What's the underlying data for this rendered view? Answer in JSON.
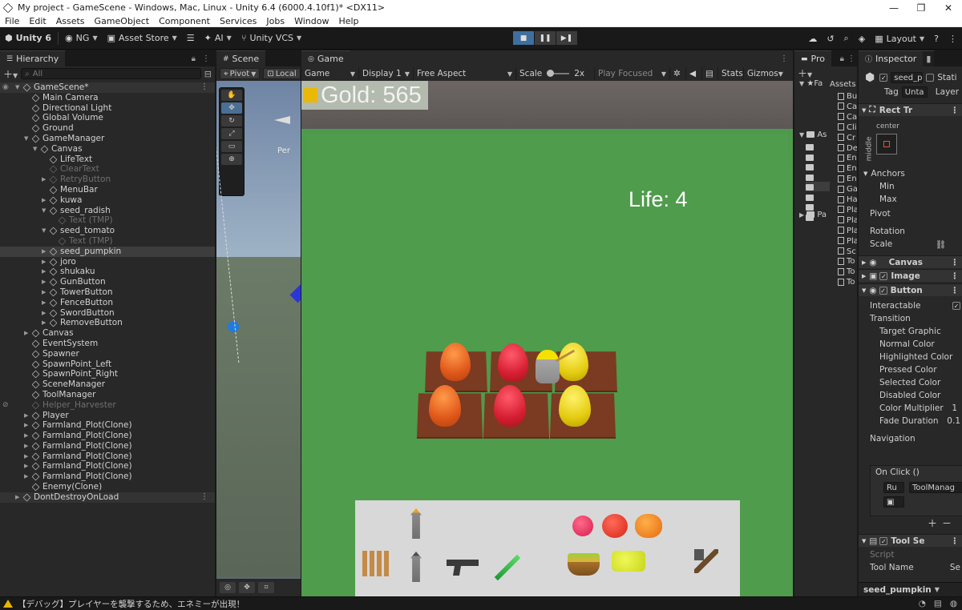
{
  "window": {
    "title": "My project - GameScene - Windows, Mac, Linux - Unity 6.4 (6000.4.10f1)* <DX11>",
    "minimize": "—",
    "maximize": "❐",
    "close": "✕"
  },
  "menu": [
    "File",
    "Edit",
    "Assets",
    "GameObject",
    "Component",
    "Services",
    "Jobs",
    "Window",
    "Help"
  ],
  "toolbar": {
    "unity_label": "Unity 6",
    "account": "NG",
    "asset_store": "Asset Store",
    "ai": "AI",
    "vcs": "Unity VCS",
    "layout": "Layout"
  },
  "hierarchy": {
    "tab": "Hierarchy",
    "search_placeholder": "All",
    "rows": [
      {
        "label": "GameScene*",
        "indent": 0,
        "arrow": "down",
        "scene": true
      },
      {
        "label": "Main Camera",
        "indent": 1
      },
      {
        "label": "Directional Light",
        "indent": 1
      },
      {
        "label": "Global Volume",
        "indent": 1
      },
      {
        "label": "Ground",
        "indent": 1
      },
      {
        "label": "GameManager",
        "indent": 1,
        "arrow": "down"
      },
      {
        "label": "Canvas",
        "indent": 2,
        "arrow": "down"
      },
      {
        "label": "LifeText",
        "indent": 3
      },
      {
        "label": "ClearText",
        "indent": 3,
        "dim": true
      },
      {
        "label": "RetryButton",
        "indent": 3,
        "arrow": "right",
        "dim": true
      },
      {
        "label": "MenuBar",
        "indent": 3
      },
      {
        "label": "kuwa",
        "indent": 3,
        "arrow": "right"
      },
      {
        "label": "seed_radish",
        "indent": 3,
        "arrow": "down"
      },
      {
        "label": "Text (TMP)",
        "indent": 4,
        "dim": true
      },
      {
        "label": "seed_tomato",
        "indent": 3,
        "arrow": "down"
      },
      {
        "label": "Text (TMP)",
        "indent": 4,
        "dim": true
      },
      {
        "label": "seed_pumpkin",
        "indent": 3,
        "arrow": "right",
        "selected": true
      },
      {
        "label": "joro",
        "indent": 3,
        "arrow": "right"
      },
      {
        "label": "shukaku",
        "indent": 3,
        "arrow": "right"
      },
      {
        "label": "GunButton",
        "indent": 3,
        "arrow": "right"
      },
      {
        "label": "TowerButton",
        "indent": 3,
        "arrow": "right"
      },
      {
        "label": "FenceButton",
        "indent": 3,
        "arrow": "right"
      },
      {
        "label": "SwordButton",
        "indent": 3,
        "arrow": "right"
      },
      {
        "label": "RemoveButton",
        "indent": 3,
        "arrow": "right"
      },
      {
        "label": "Canvas",
        "indent": 1,
        "arrow": "right"
      },
      {
        "label": "EventSystem",
        "indent": 1
      },
      {
        "label": "Spawner",
        "indent": 1
      },
      {
        "label": "SpawnPoint_Left",
        "indent": 1
      },
      {
        "label": "SpawnPoint_Right",
        "indent": 1
      },
      {
        "label": "SceneManager",
        "indent": 1
      },
      {
        "label": "ToolManager",
        "indent": 1
      },
      {
        "label": "Helper_Harvester",
        "indent": 1,
        "dim": true
      },
      {
        "label": "Player",
        "indent": 1,
        "arrow": "right"
      },
      {
        "label": "Farmland_Plot(Clone)",
        "indent": 1,
        "arrow": "right"
      },
      {
        "label": "Farmland_Plot(Clone)",
        "indent": 1,
        "arrow": "right"
      },
      {
        "label": "Farmland_Plot(Clone)",
        "indent": 1,
        "arrow": "right"
      },
      {
        "label": "Farmland_Plot(Clone)",
        "indent": 1,
        "arrow": "right"
      },
      {
        "label": "Farmland_Plot(Clone)",
        "indent": 1,
        "arrow": "right"
      },
      {
        "label": "Farmland_Plot(Clone)",
        "indent": 1,
        "arrow": "right"
      },
      {
        "label": "Enemy(Clone)",
        "indent": 1
      },
      {
        "label": "DontDestroyOnLoad",
        "indent": 0,
        "arrow": "right",
        "scene": true
      }
    ]
  },
  "scene": {
    "tab": "Scene",
    "pivot": "Pivot",
    "local": "Local",
    "persp": "Per"
  },
  "game": {
    "tab": "Game",
    "mode": "Game",
    "display": "Display 1",
    "aspect": "Free Aspect",
    "scale_label": "Scale",
    "scale_value": "2x",
    "play_focused": "Play Focused",
    "stats": "Stats",
    "gizmos": "Gizmos",
    "gold_text": "Gold: 565",
    "life_text": "Life: 4"
  },
  "project": {
    "tab": "Pro",
    "assets_label": "Assets",
    "items": [
      "Bu",
      "Ca",
      "Ca",
      "Cli",
      "Cr",
      "De",
      "En",
      "En",
      "En",
      "Ga",
      "Ha",
      "Pla",
      "Pla",
      "Pla",
      "Pla",
      "Sc",
      "To",
      "To",
      "To"
    ],
    "folders": [
      "Fa",
      "As",
      "Pa"
    ]
  },
  "inspector": {
    "tab": "Inspector",
    "object_name": "seed_pu",
    "static_label": "Stati",
    "tag_label": "Tag",
    "tag_value": "Unta",
    "layer_label": "Layer",
    "rect_transform": "Rect Tr",
    "anchor_center": "center",
    "anchor_middle": "middle",
    "anchors": "Anchors",
    "min": "Min",
    "max": "Max",
    "pivot": "Pivot",
    "rotation": "Rotation",
    "scale": "Scale",
    "canvas": "Canvas",
    "image": "Image",
    "button": "Button",
    "interactable": "Interactable",
    "transition": "Transition",
    "target_graphic": "Target Graphic",
    "normal_color": "Normal Color",
    "highlighted_color": "Highlighted Color",
    "pressed_color": "Pressed Color",
    "selected_color": "Selected Color",
    "disabled_color": "Disabled Color",
    "color_multiplier": "Color Multiplier",
    "color_multiplier_value": "1",
    "fade_duration": "Fade Duration",
    "fade_duration_value": "0.1",
    "navigation": "Navigation",
    "on_click": "On Click ()",
    "runtime": "Ru",
    "tool_manager": "ToolManag",
    "tool_script": "Tool Se",
    "script": "Script",
    "tool_name": "Tool Name",
    "tool_name_value": "Se",
    "footer_object": "seed_pumpkin"
  },
  "status": {
    "message": "【デバッグ】プレイヤーを襲撃するため、エネミーが出現！"
  },
  "colors": {
    "selection": "#3d3d3d",
    "accent": "#3f6f9f",
    "gold_icon": "#f6c100",
    "grass": "#4f9c4c"
  }
}
